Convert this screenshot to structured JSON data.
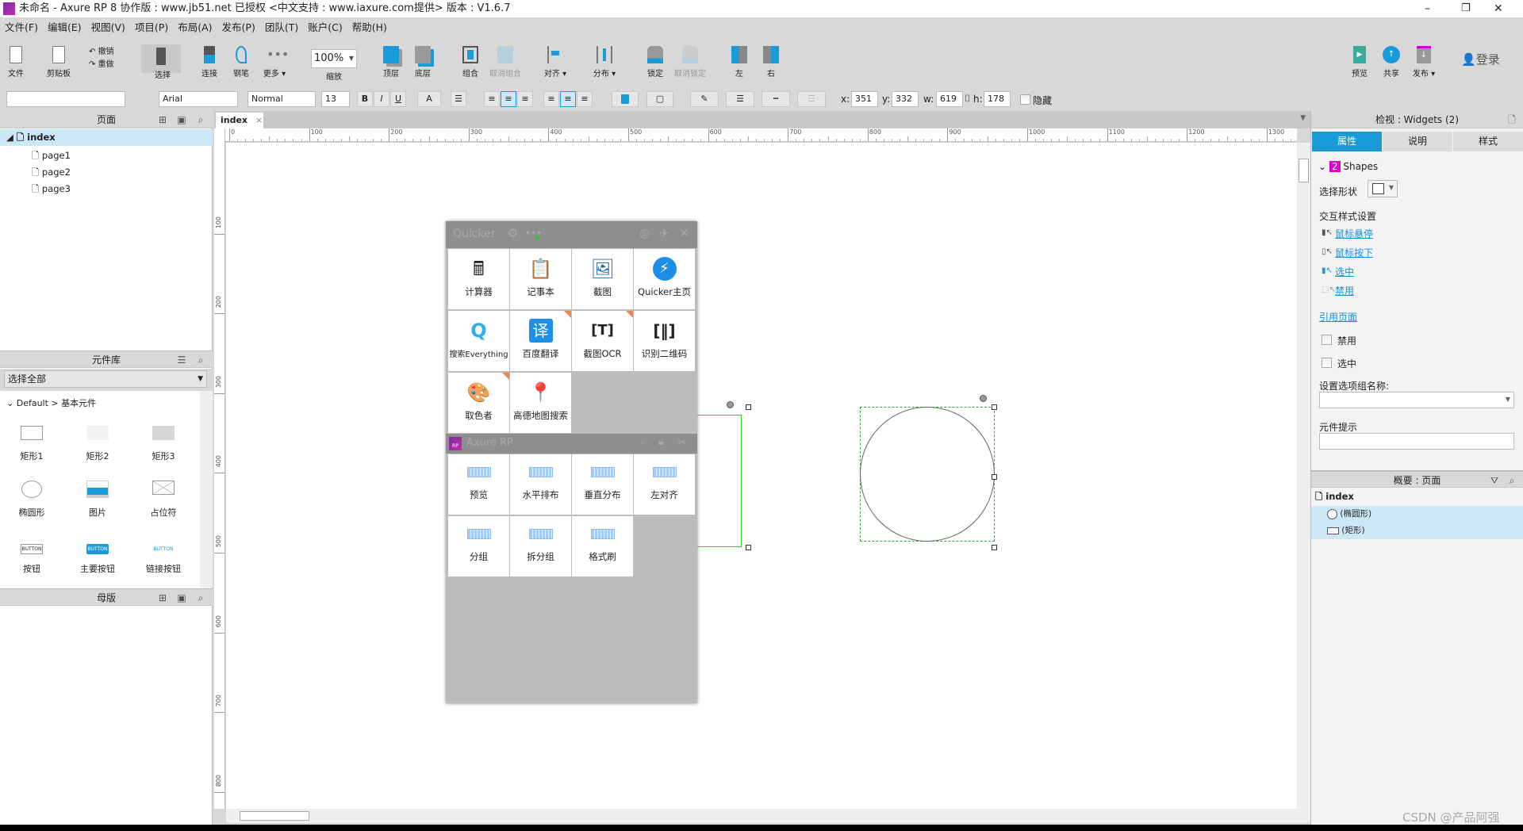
{
  "window": {
    "title": "未命名 - Axure RP 8 协作版 : www.jb51.net  已授权      <中文支持 : www.iaxure.com提供> 版本 : V1.6.7",
    "logo": "RP"
  },
  "menu": [
    "文件(F)",
    "编辑(E)",
    "视图(V)",
    "项目(P)",
    "布局(A)",
    "发布(P)",
    "团队(T)",
    "账户(C)",
    "帮助(H)"
  ],
  "toolbar": {
    "file": "文件",
    "clipboard": "剪贴板",
    "undo": "撤销",
    "redo": "重做",
    "select": "选择",
    "connect": "连接",
    "pen": "钢笔",
    "more": "更多 ▾",
    "zoom_value": "100%",
    "zoom": "缩放",
    "front": "顶层",
    "back": "底层",
    "group": "组合",
    "ungroup": "取消组合",
    "align": "对齐 ▾",
    "distribute": "分布 ▾",
    "lock": "锁定",
    "unlock": "取消锁定",
    "left": "左",
    "right": "右",
    "preview": "预览",
    "share": "共享",
    "publish": "发布 ▾",
    "login": "登录"
  },
  "format": {
    "font": "Arial",
    "weight": "Normal",
    "size": "13",
    "x_label": "x:",
    "x": "351",
    "y_label": "y:",
    "y": "332",
    "w_label": "w:",
    "w": "619",
    "h_label": "h:",
    "h": "178",
    "hidden": "隐藏",
    "accent": "#1a9ad6"
  },
  "pages": {
    "title": "页面",
    "items": [
      {
        "label": "index"
      },
      {
        "label": "page1"
      },
      {
        "label": "page2"
      },
      {
        "label": "page3"
      }
    ]
  },
  "library": {
    "title": "元件库",
    "select": "选择全部",
    "group": "Default > 基本元件",
    "widgets": [
      "矩形1",
      "矩形2",
      "矩形3",
      "椭圆形",
      "图片",
      "占位符",
      "按钮",
      "主要按钮",
      "链接按钮"
    ],
    "button_text": "BUTTON"
  },
  "masters": {
    "title": "母版"
  },
  "canvas": {
    "tab": "index",
    "ruler_x": [
      "0",
      "100",
      "200",
      "300",
      "400",
      "500",
      "600",
      "700",
      "800",
      "900",
      "1000",
      "1100",
      "1200",
      "1300"
    ],
    "ruler_y": [
      "100",
      "200",
      "300",
      "400",
      "500",
      "600",
      "700",
      "800"
    ]
  },
  "quicker": {
    "title": "Quicker",
    "items": [
      "计算器",
      "记事本",
      "截图",
      "Quicker主页",
      "搜索Everything",
      "百度翻译",
      "截图OCR",
      "识别二维码",
      "取色者",
      "高德地图搜索"
    ],
    "axure_title": "Axure RP",
    "axure_items": [
      "预览",
      "水平排布",
      "垂直分布",
      "左对齐",
      "分组",
      "拆分组",
      "格式刷"
    ]
  },
  "inspector": {
    "title": "检视 : Widgets (2)",
    "tabs": [
      "属性",
      "说明",
      "样式"
    ],
    "count": "2",
    "shapes": "Shapes",
    "select_shape": "选择形状",
    "interaction": "交互样式设置",
    "links": [
      "鼠标悬停",
      "鼠标按下",
      "选中",
      "禁用"
    ],
    "ref_page": "引用页面",
    "disabled": "禁用",
    "selected": "选中",
    "group_name": "设置选项组名称:",
    "tooltip": "元件提示"
  },
  "outline": {
    "title": "概要 : 页面",
    "page": "index",
    "items": [
      "(椭圆形)",
      "(矩形)"
    ]
  },
  "watermark": "CSDN @产品阿强"
}
